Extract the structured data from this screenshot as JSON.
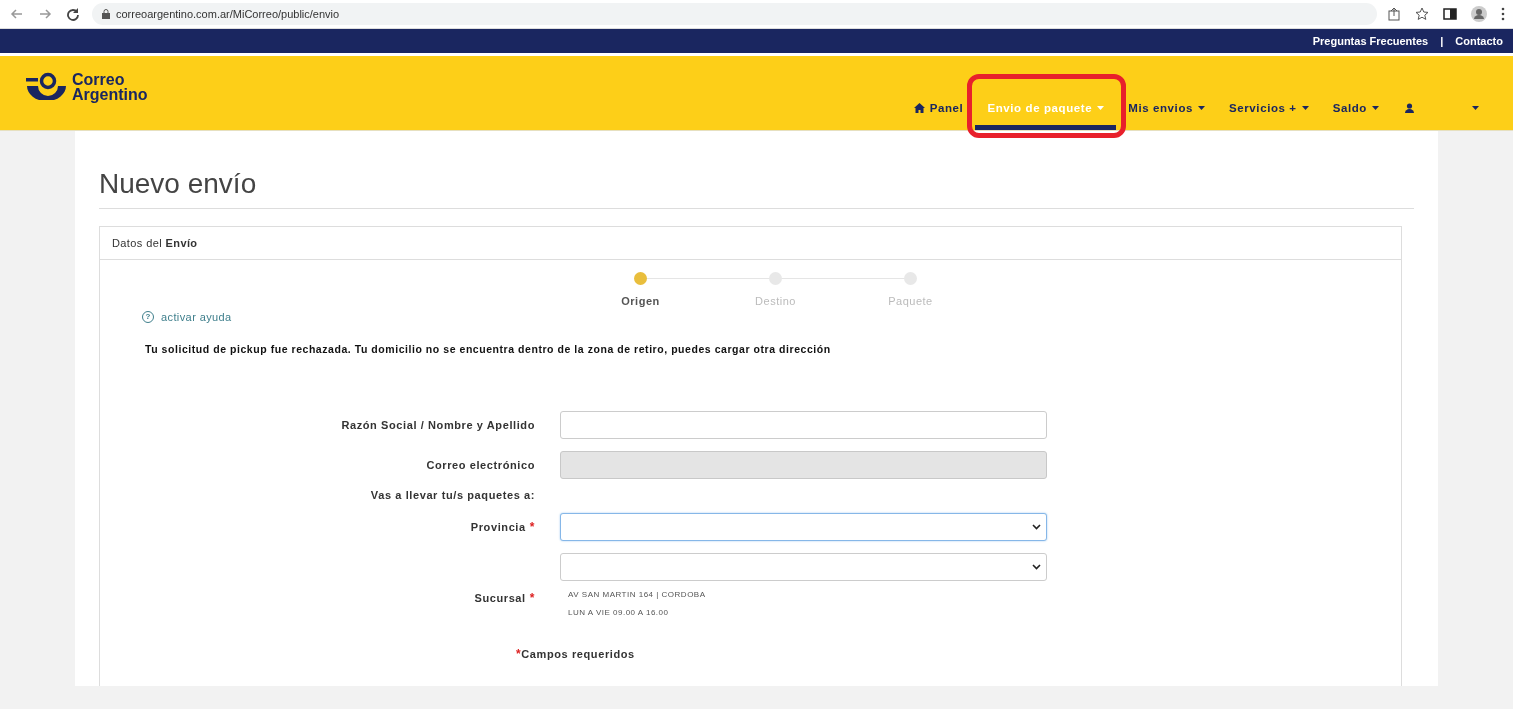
{
  "browser": {
    "url": "correoargentino.com.ar/MiCorreo/public/envio"
  },
  "top_links": [
    "Preguntas Frecuentes",
    "|",
    "Contacto"
  ],
  "logo": {
    "line_1": "Correo",
    "line_2": "Argentino"
  },
  "nav": [
    {
      "label": "Panel",
      "caret": false,
      "selected": false,
      "highlighted": false
    },
    {
      "label": "Envio de paquete",
      "caret": true,
      "selected": true,
      "highlighted": true
    },
    {
      "label": "Mis envios",
      "caret": true,
      "selected": false,
      "highlighted": false
    },
    {
      "label": "Servicios +",
      "caret": true,
      "selected": false,
      "highlighted": false
    },
    {
      "label": "Saldo",
      "caret": true,
      "selected": false,
      "highlighted": false
    },
    {
      "caret": true,
      "selected": false,
      "highlighted": false
    }
  ],
  "page_title": "Nuevo envío",
  "panel": {
    "title": "Datos del **Envío**",
    "steps": [
      {
        "label": "Origen",
        "selected": true
      },
      {
        "label": "Destino",
        "selected": false
      },
      {
        "label": "Paquete",
        "selected": false
      }
    ],
    "help_icon": "?",
    "help_link": "activar ayuda",
    "message": "Tu solicitud de pickup fue rechazada. Tu domicilio no se encuentra dentro de la zona de retiro, puedes cargar otra dirección",
    "fields": [
      {
        "kind": "text",
        "label": "Razón Social / Nombre y Apellido",
        "disabled": false,
        "focused": false
      },
      {
        "kind": "text",
        "label": "Correo electrónico",
        "disabled": true,
        "focused": false
      },
      {
        "kind": "heading",
        "label": "Vas a llevar tu/s paquetes a:"
      },
      {
        "kind": "select",
        "label": "Provincia",
        "required_mark": "*",
        "disabled": false,
        "focused": true
      },
      {
        "kind": "select",
        "label": "Sucursal",
        "required_mark": "*",
        "disabled": false,
        "focused": false,
        "details": [
          "AV SAN MARTIN 164 | CORDOBA",
          "LUN A VIE 09.00 A 16.00"
        ]
      }
    ],
    "required_note_mark": "*",
    "required_note": "Campos requeridos"
  }
}
